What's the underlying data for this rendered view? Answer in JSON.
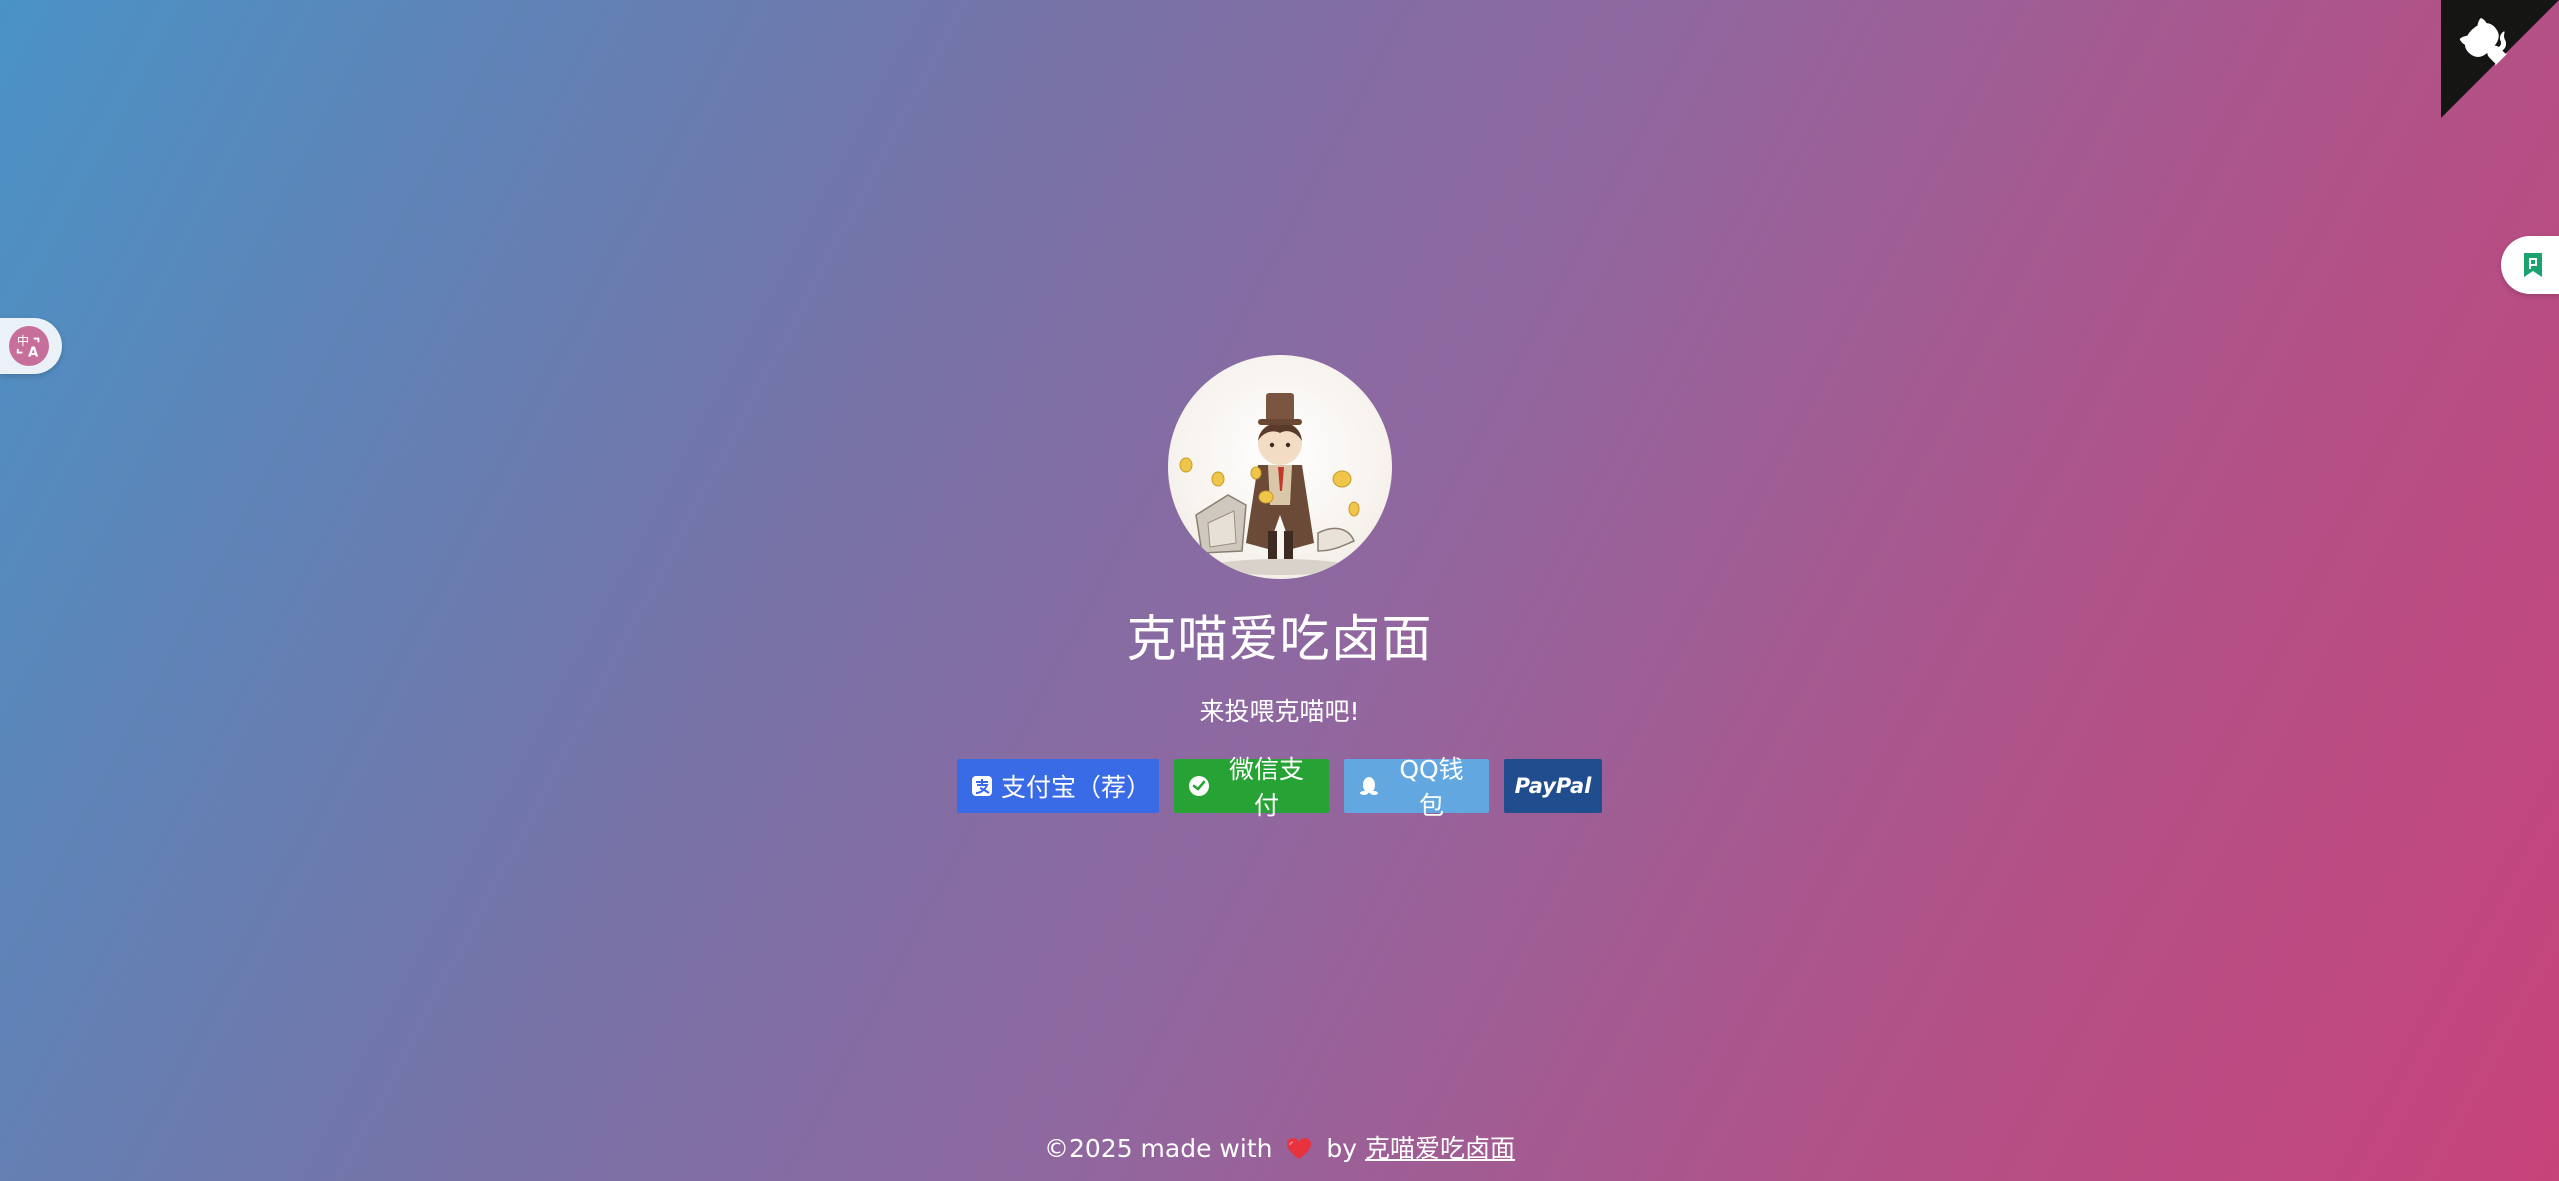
{
  "profile": {
    "name": "克喵爱吃卤面",
    "tagline": "来投喂克喵吧!",
    "avatar_icon": "cartoon-detective-avatar"
  },
  "buttons": {
    "alipay": {
      "label": "支付宝（荐）",
      "icon": "alipay-icon",
      "color": "#3a6be6"
    },
    "wechat": {
      "label": "微信支付",
      "icon": "wechat-icon",
      "color": "#27a234"
    },
    "qq": {
      "label": "QQ钱包",
      "icon": "qq-penguin-icon",
      "color": "#62a7e0"
    },
    "paypal": {
      "label": "PayPal",
      "color": "#1f4d8e"
    }
  },
  "footer": {
    "prefix": "©2025 made with",
    "by": "by",
    "author_link": "克喵爱吃卤面"
  },
  "widgets": {
    "github_corner_icon": "github-octocat-icon",
    "translate_icon": "translate-icon",
    "bookmark_icon": "bookmark-icon"
  }
}
